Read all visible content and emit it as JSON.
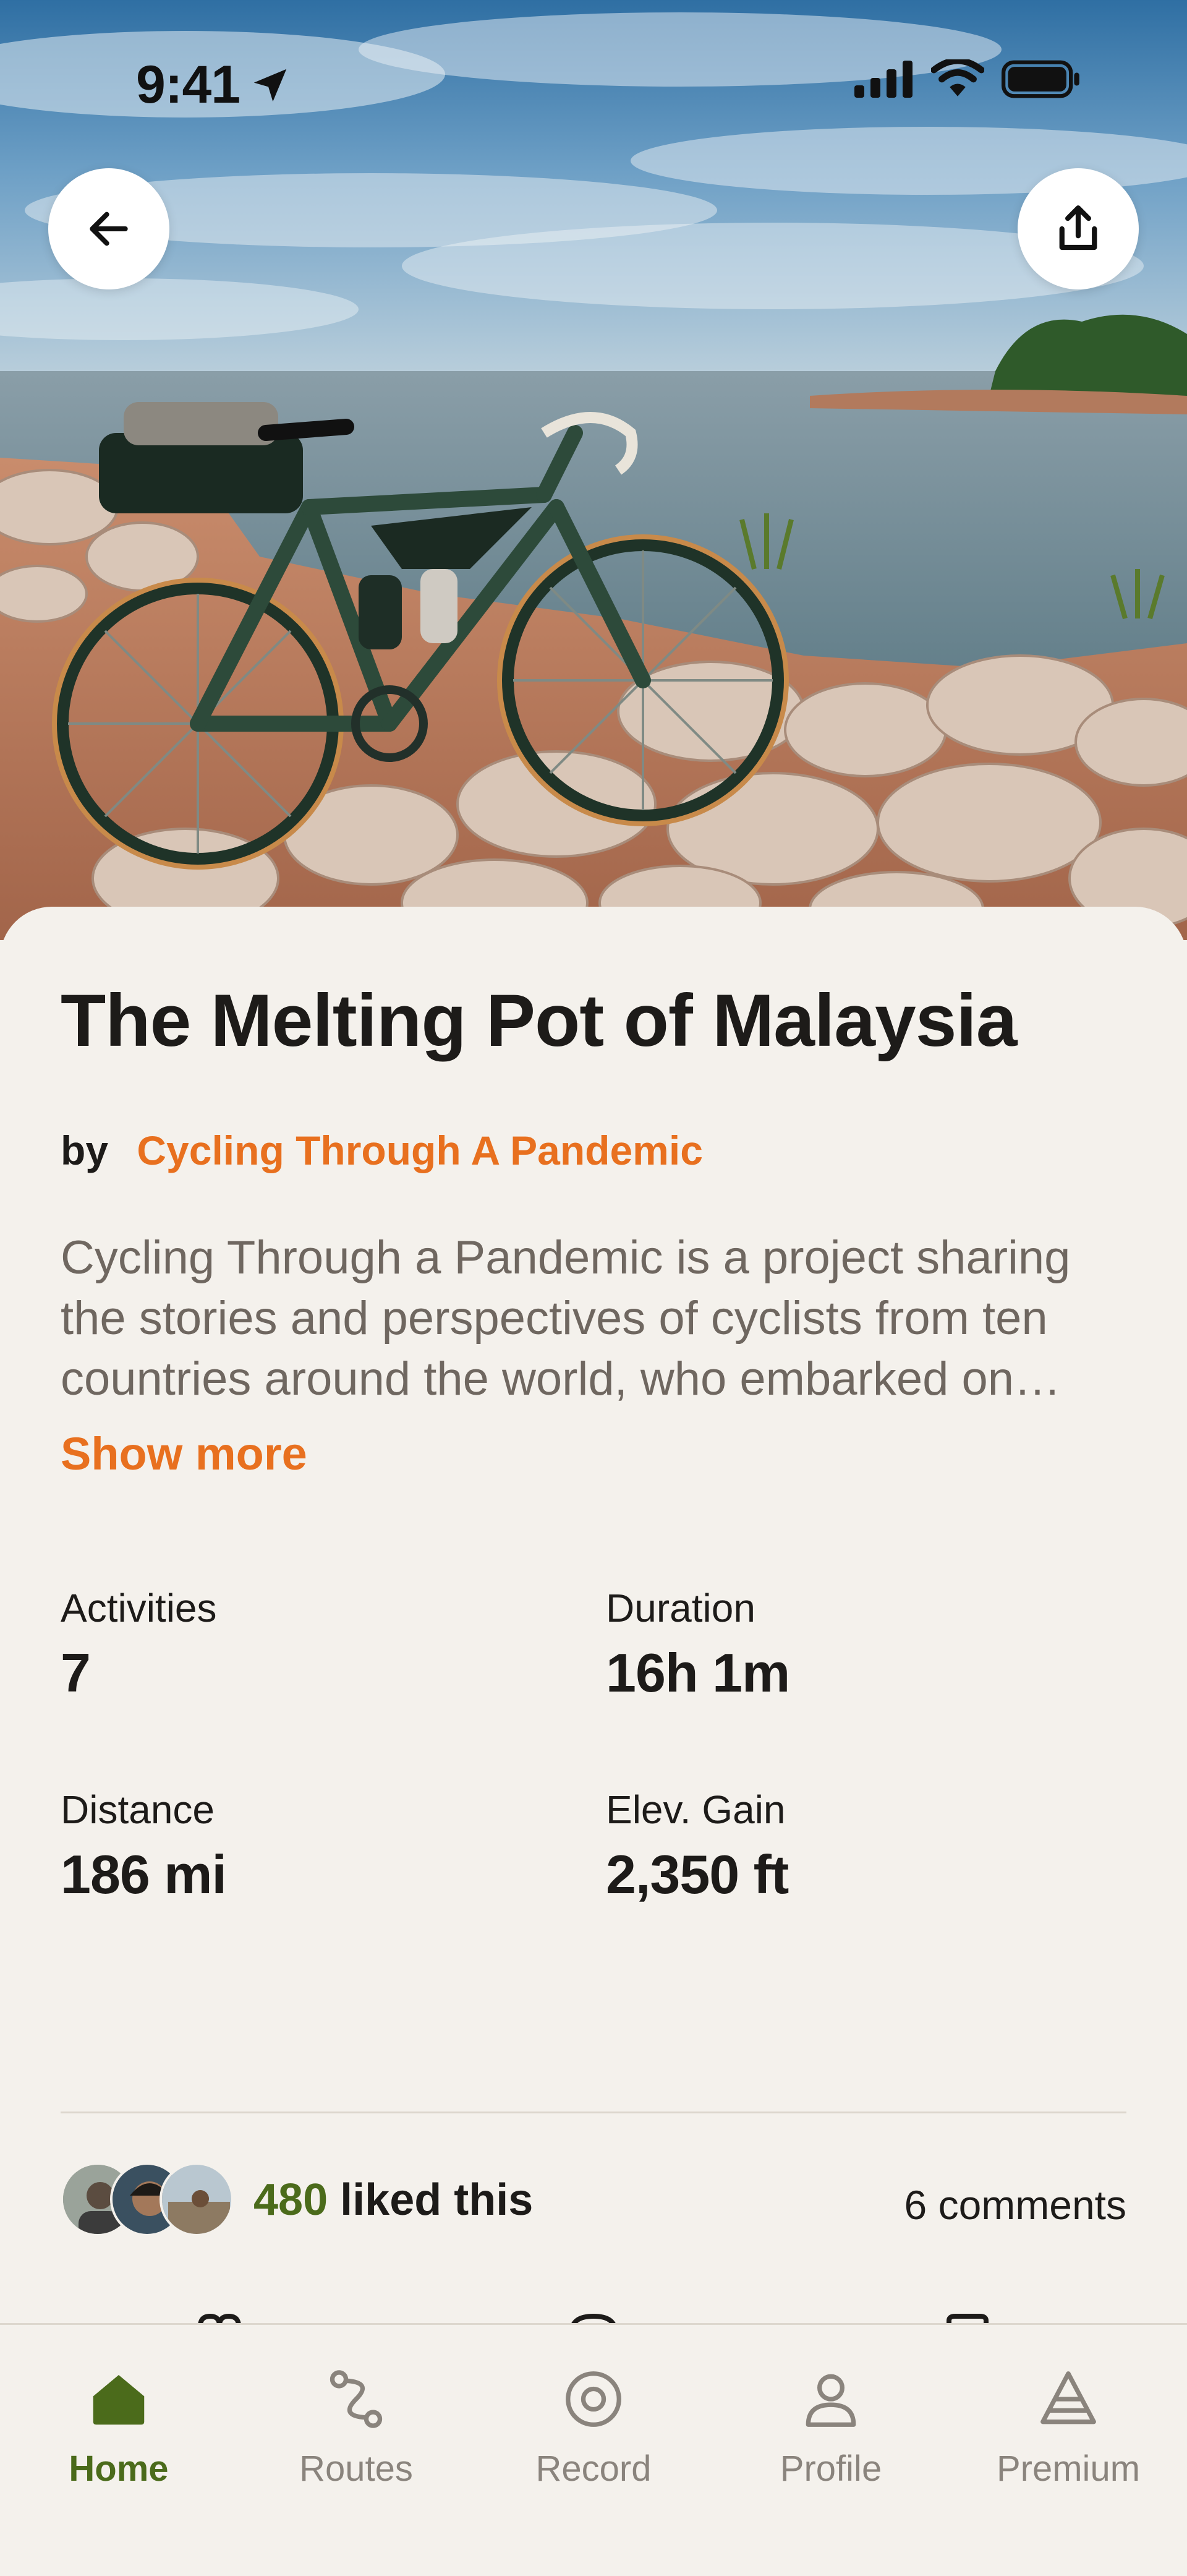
{
  "status_bar": {
    "time": "9:41"
  },
  "header": {
    "back_icon": "arrow-left-icon",
    "share_icon": "share-icon"
  },
  "journey": {
    "title": "The Melting Pot of Malaysia",
    "by_label": "by",
    "author": "Cycling Through A Pandemic",
    "description": "Cycling Through a Pandemic is a project sharing the stories and perspectives of cyclists from ten countries around the world, who embarked on…",
    "show_more": "Show more"
  },
  "stats": [
    {
      "label": "Activities",
      "value": "7"
    },
    {
      "label": "Duration",
      "value": "16h 1m"
    },
    {
      "label": "Distance",
      "value": "186 mi"
    },
    {
      "label": "Elev. Gain",
      "value": "2,350 ft"
    }
  ],
  "social": {
    "likes_count": "480",
    "likes_text": "liked this",
    "comments": "6 comments"
  },
  "tabbar": {
    "items": [
      {
        "label": "Home",
        "icon": "home-icon",
        "active": true
      },
      {
        "label": "Routes",
        "icon": "routes-icon",
        "active": false
      },
      {
        "label": "Record",
        "icon": "record-icon",
        "active": false
      },
      {
        "label": "Profile",
        "icon": "profile-icon",
        "active": false
      },
      {
        "label": "Premium",
        "icon": "premium-icon",
        "active": false
      }
    ]
  },
  "colors": {
    "accent_orange": "#e8701f",
    "accent_green": "#4b6b1b",
    "background": "#f4f1ec"
  }
}
